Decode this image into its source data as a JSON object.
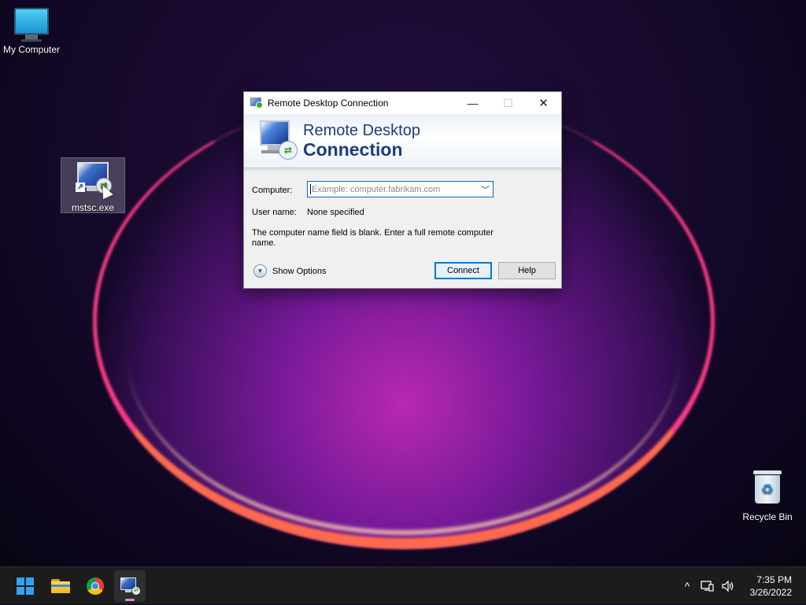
{
  "desktop": {
    "icons": [
      {
        "label": "My Computer",
        "icon": "monitor-icon"
      },
      {
        "label": "mstsc.exe",
        "icon": "remote-desktop-icon"
      },
      {
        "label": "Recycle Bin",
        "icon": "recycle-bin-icon"
      }
    ]
  },
  "dialog": {
    "title": "Remote Desktop Connection",
    "banner_line1": "Remote Desktop",
    "banner_line2": "Connection",
    "computer_label": "Computer:",
    "computer_value": "",
    "computer_placeholder": "Example: computer.fabrikam.com",
    "username_label": "User name:",
    "username_value": "None specified",
    "message": "The computer name field is blank. Enter a full remote computer name.",
    "show_options_label": "Show Options",
    "connect_label": "Connect",
    "help_label": "Help",
    "minimize_symbol": "—",
    "maximize_symbol": "☐",
    "close_symbol": "✕"
  },
  "taskbar": {
    "apps": [
      {
        "name": "start",
        "icon": "windows-logo-icon"
      },
      {
        "name": "file-explorer",
        "icon": "folder-icon"
      },
      {
        "name": "chrome",
        "icon": "chrome-icon"
      },
      {
        "name": "remote-desktop",
        "icon": "remote-desktop-icon",
        "active": true
      }
    ],
    "tray": {
      "chevron": "^",
      "time": "7:35 PM",
      "date": "3/26/2022"
    }
  },
  "colors": {
    "accent": "#0078d7",
    "banner_text": "#1a3e7a",
    "taskbar": "#1c1c1c"
  }
}
